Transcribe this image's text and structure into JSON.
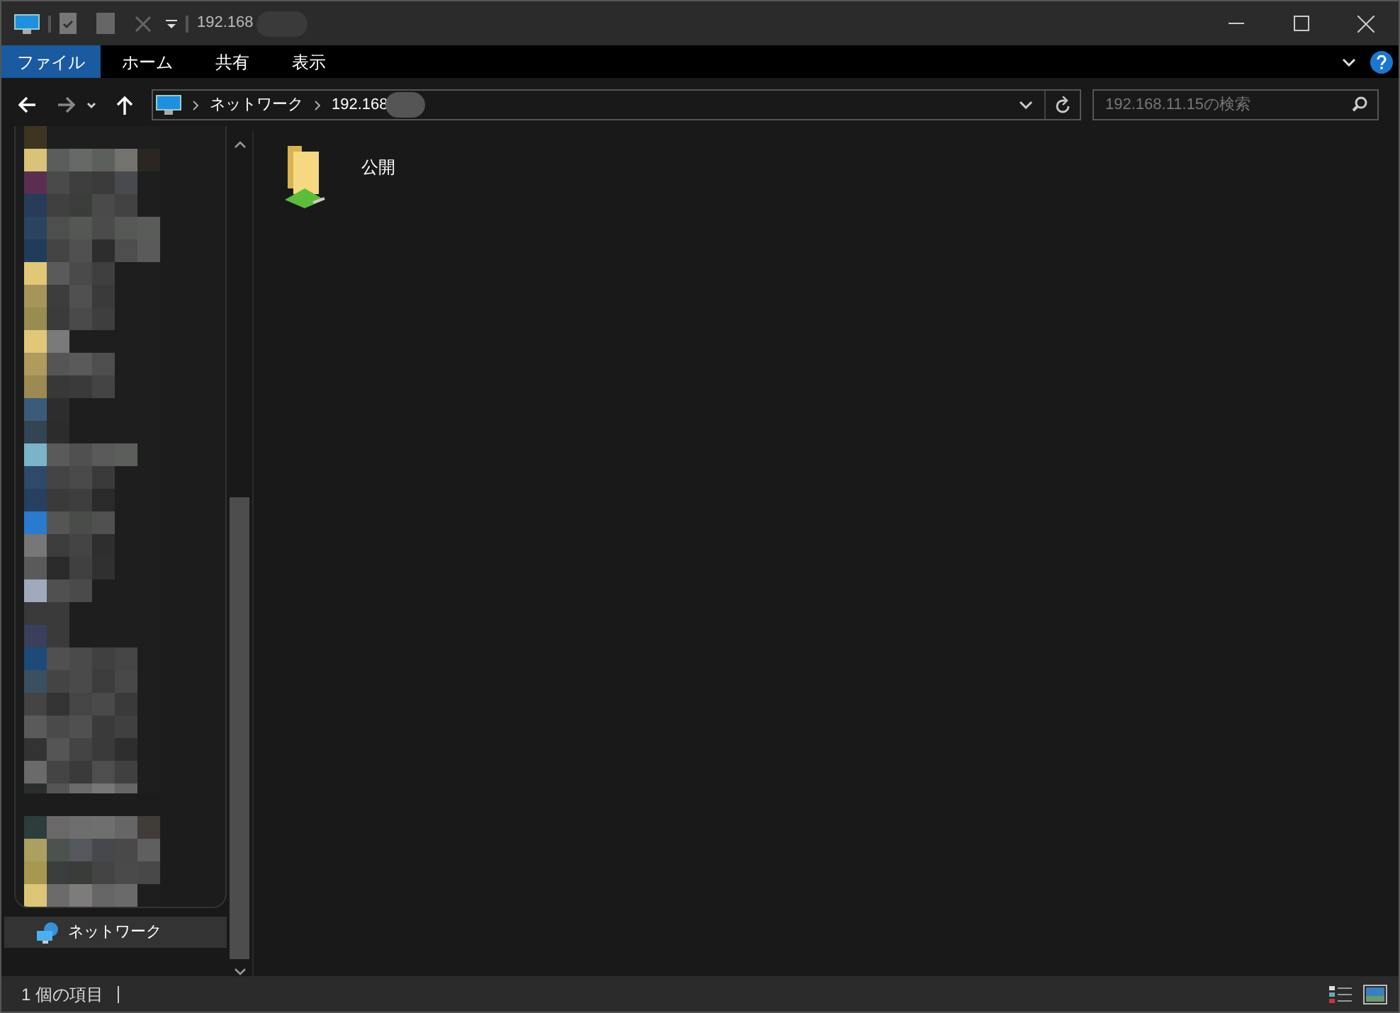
{
  "window": {
    "title": "192.168"
  },
  "ribbon_tabs": [
    {
      "label": "ファイル",
      "selected": true
    },
    {
      "label": "ホーム",
      "selected": false
    },
    {
      "label": "共有",
      "selected": false
    },
    {
      "label": "表示",
      "selected": false
    }
  ],
  "address_bar": {
    "breadcrumbs": [
      "ネットワーク",
      "192.168"
    ]
  },
  "search": {
    "placeholder": "192.168.11.15の検索"
  },
  "nav_pane": {
    "items": [
      {
        "label": "ネットワーク",
        "selected": true
      }
    ]
  },
  "content": {
    "items": [
      {
        "name": "公開"
      }
    ]
  },
  "status_bar": {
    "count": "1 個の項目",
    "view_buttons": [
      {
        "kind": "details",
        "selected": false
      },
      {
        "kind": "large_icons",
        "selected": true
      }
    ]
  }
}
